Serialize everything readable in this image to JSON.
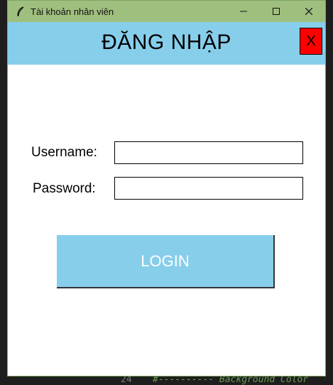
{
  "window": {
    "title": "Tài khoản nhân viên",
    "controls": {
      "minimize": "—",
      "maximize": "☐",
      "close": "✕"
    }
  },
  "header": {
    "title": "ĐĂNG NHẬP",
    "close_label": "X"
  },
  "form": {
    "username_label": "Username:",
    "username_value": "",
    "password_label": "Password:",
    "password_value": "",
    "login_label": "LOGIN"
  },
  "background_editor": {
    "line_number": "24",
    "code_text": "#---------- Background Color"
  },
  "colors": {
    "header_bg": "#87ceeb",
    "titlebar_bg": "#9fbf7f",
    "close_button_bg": "#ff0000",
    "login_button_bg": "#87ceeb"
  }
}
